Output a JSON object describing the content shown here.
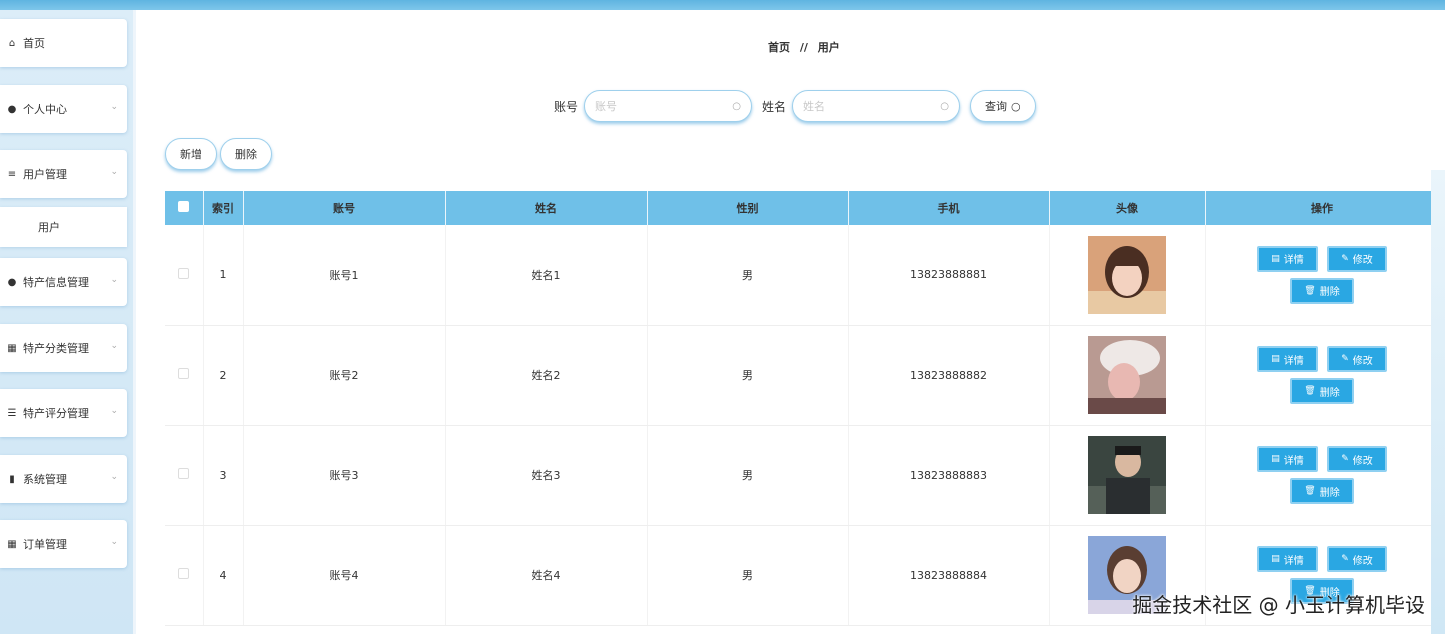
{
  "sidebar": {
    "items": [
      {
        "label": "首页",
        "icon": "home-icon",
        "glyph": "⌂",
        "has_chevron": false
      },
      {
        "label": "个人中心",
        "icon": "user-icon",
        "glyph": "●",
        "has_chevron": true
      },
      {
        "label": "用户管理",
        "icon": "list-icon",
        "glyph": "≡",
        "has_chevron": true
      },
      {
        "label": "特产信息管理",
        "icon": "user-icon",
        "glyph": "●",
        "has_chevron": true
      },
      {
        "label": "特产分类管理",
        "icon": "grid-icon",
        "glyph": "▦",
        "has_chevron": true
      },
      {
        "label": "特产评分管理",
        "icon": "sliders-icon",
        "glyph": "☰",
        "has_chevron": true
      },
      {
        "label": "系统管理",
        "icon": "trash-icon",
        "glyph": "▮",
        "has_chevron": true
      },
      {
        "label": "订单管理",
        "icon": "grid-icon",
        "glyph": "▦",
        "has_chevron": true
      }
    ],
    "sub_item": "用户"
  },
  "breadcrumb": {
    "home": "首页",
    "sep": "//",
    "current": "用户"
  },
  "search": {
    "account_label": "账号",
    "account_placeholder": "账号",
    "name_label": "姓名",
    "name_placeholder": "姓名",
    "query_label": "查询"
  },
  "actions": {
    "add": "新增",
    "delete": "删除"
  },
  "table": {
    "headers": [
      "索引",
      "账号",
      "姓名",
      "性别",
      "手机",
      "头像",
      "操作"
    ],
    "rows": [
      {
        "index": "1",
        "account": "账号1",
        "name": "姓名1",
        "gender": "男",
        "phone": "13823888881"
      },
      {
        "index": "2",
        "account": "账号2",
        "name": "姓名2",
        "gender": "男",
        "phone": "13823888882"
      },
      {
        "index": "3",
        "account": "账号3",
        "name": "姓名3",
        "gender": "男",
        "phone": "13823888883"
      },
      {
        "index": "4",
        "account": "账号4",
        "name": "姓名4",
        "gender": "男",
        "phone": "13823888884"
      }
    ],
    "op_detail": "详情",
    "op_edit": "修改",
    "op_delete": "删除"
  },
  "watermark": "掘金技术社区 @ 小玉计算机毕设",
  "colors": {
    "accent": "#2aa7e3",
    "header": "#6fc0e8",
    "topbar": "#5fb4e0"
  }
}
